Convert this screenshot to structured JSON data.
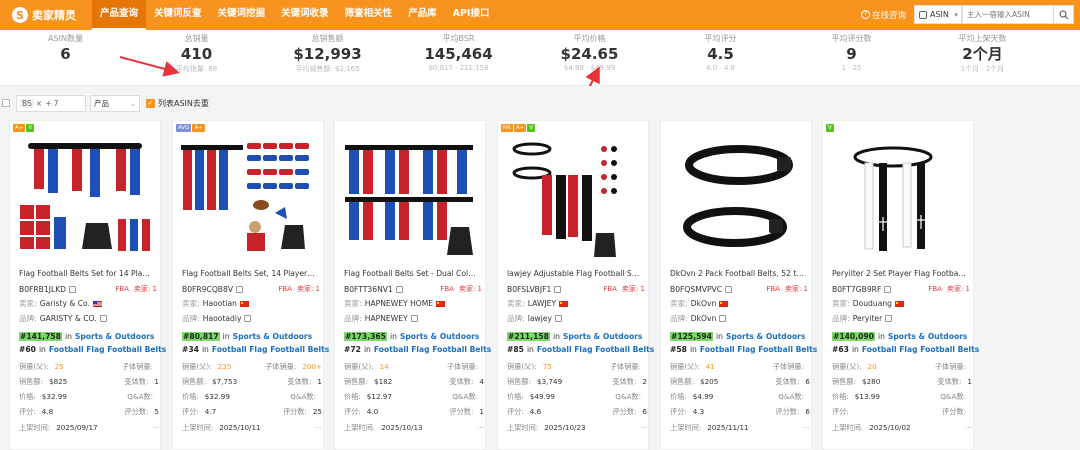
{
  "app": {
    "logo": "卖家精灵",
    "logo_letter": "S"
  },
  "nav": [
    "产品查询",
    "关键词反查",
    "关键词挖掘",
    "关键词收录",
    "筛查相关性",
    "产品库",
    "API接口"
  ],
  "tools": {
    "online": "在线咨询",
    "market": "ASIN",
    "search_placeholder": "主入一宿输入ASIN"
  },
  "stats": [
    {
      "label": "ASIN数量",
      "value": "6",
      "sub": ""
    },
    {
      "label": "总销量",
      "value": "410",
      "sub": "平均销量: 68"
    },
    {
      "label": "总销售额",
      "value": "$12,993",
      "sub": "平均销售额: $2,165"
    },
    {
      "label": "平均BSR",
      "value": "145,464",
      "sub": "80,817 · 211,158"
    },
    {
      "label": "平均价格",
      "value": "$24.65",
      "sub": "$4.99 · $49.99"
    },
    {
      "label": "平均评分",
      "value": "4.5",
      "sub": "4.0 · 4.8"
    },
    {
      "label": "平均评分数",
      "value": "9",
      "sub": "1 · 25"
    },
    {
      "label": "平均上架天数",
      "value": "2个月",
      "sub": "1个月 · 2个月"
    }
  ],
  "filters": {
    "tag": "BS",
    "tag_more": "+ 7",
    "type": "产品",
    "dedup": "列表ASIN去重"
  },
  "labels": {
    "sales": "销量(父):",
    "child_sales": "子体销量:",
    "revenue": "销售额:",
    "variants": "变体数:",
    "price": "价格:",
    "qa": "Q&A数:",
    "rating": "评分:",
    "reviews": "评分数:",
    "date": "上架时间:",
    "seller": "卖家:",
    "brand": "品牌:",
    "in": "in",
    "fba": "FBA",
    "seller_count": "卖家: 1"
  },
  "products": [
    {
      "badges": [
        "A+",
        "V"
      ],
      "title": "Flag Football Belts Set for 14 Player...",
      "asin": "B0FRB1JLKD",
      "seller": "Garisty & Co.",
      "flag": "us",
      "brand": "GARISTY & CO.",
      "rank1": "#141,758",
      "cat1": "Sports & Outdoors",
      "rank2": "#60",
      "cat2": "Football Flag Football Belts",
      "sales": "25",
      "child_sales": "",
      "revenue": "$825",
      "variants": "1",
      "price": "$32.99",
      "qa": "",
      "rating": "4.8",
      "reviews": "5",
      "date": "2025/09/17"
    },
    {
      "badges": [
        "AVG",
        "A+"
      ],
      "title": "Flag Football Belts Set, 14 Player A...",
      "asin": "B0FR9CQB8V",
      "seller": "Haootian",
      "flag": "cn",
      "brand": "Haootadiy",
      "rank1": "#80,817",
      "cat1": "Sports & Outdoors",
      "rank2": "#34",
      "cat2": "Football Flag Football Belts",
      "sales": "235",
      "child_sales": "200+",
      "revenue": "$7,753",
      "variants": "1",
      "price": "$32.99",
      "qa": "",
      "rating": "4.7",
      "reviews": "25",
      "date": "2025/10/11"
    },
    {
      "badges": [],
      "title": "Flag Football Belts Set - Dual Color ...",
      "asin": "B0FTT36NV1",
      "seller": "HAPNEWEY HOME",
      "flag": "cn",
      "brand": "HAPNEWEY",
      "rank1": "#173,365",
      "cat1": "Sports & Outdoors",
      "rank2": "#72",
      "cat2": "Football Flag Football Belts",
      "sales": "14",
      "child_sales": "",
      "revenue": "$182",
      "variants": "4",
      "price": "$12.97",
      "qa": "",
      "rating": "4.0",
      "reviews": "1",
      "date": "2025/10/13"
    },
    {
      "badges": [
        "NR",
        "A+",
        "V"
      ],
      "title": "lawjey Adjustable Flag Football Set,...",
      "asin": "B0FSLVBJF1",
      "seller": "LAWJEY",
      "flag": "cn",
      "brand": "lawjey",
      "rank1": "#211,158",
      "cat1": "Sports & Outdoors",
      "rank2": "#85",
      "cat2": "Football Flag Football Belts",
      "sales": "75",
      "child_sales": "",
      "revenue": "$3,749",
      "variants": "2",
      "price": "$49.99",
      "qa": "",
      "rating": "4.6",
      "reviews": "6",
      "date": "2025/10/23"
    },
    {
      "badges": [],
      "title": "DkOvn 2 Pack Football Belts, 52 to ...",
      "asin": "B0FQSMVPVC",
      "seller": "DkOvn",
      "flag": "cn",
      "brand": "DkOvn",
      "rank1": "#125,594",
      "cat1": "Sports & Outdoors",
      "rank2": "#58",
      "cat2": "Football Flag Football Belts",
      "sales": "41",
      "child_sales": "",
      "revenue": "$205",
      "variants": "6",
      "price": "$4.99",
      "qa": "",
      "rating": "4.3",
      "reviews": "6",
      "date": "2025/11/11"
    },
    {
      "badges": [
        "V"
      ],
      "title": "Peryilter 2 Set Player Flag Football B...",
      "asin": "B0FT7GB9RF",
      "seller": "Douduang",
      "flag": "cn",
      "brand": "Peryiter",
      "rank1": "#140,090",
      "cat1": "Sports & Outdoors",
      "rank2": "#63",
      "cat2": "Football Flag Football Belts",
      "sales": "20",
      "child_sales": "",
      "revenue": "$280",
      "variants": "1",
      "price": "$13.99",
      "qa": "",
      "rating": "",
      "reviews": "",
      "date": "2025/10/02"
    }
  ],
  "colors": {
    "brand": "#f7931e",
    "link": "#1b6fc2",
    "rank_highlight": "#7dd96b",
    "annotation": "#e8333a"
  }
}
